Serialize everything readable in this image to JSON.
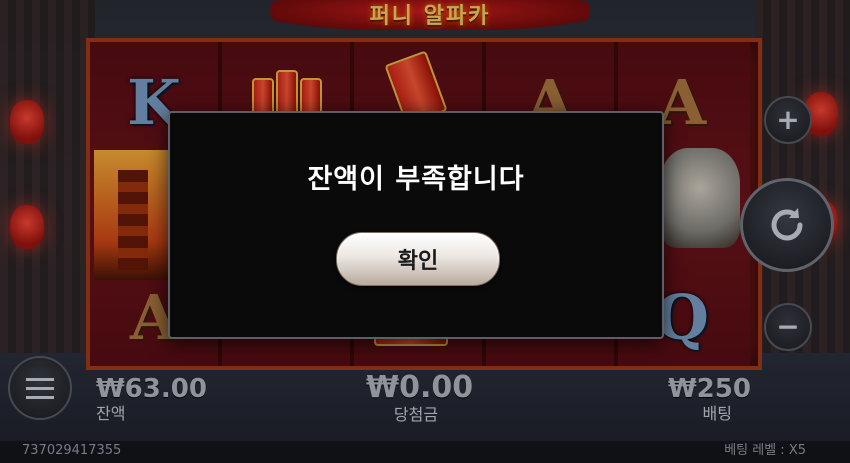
{
  "game": {
    "title": "퍼니 알파카"
  },
  "reels": {
    "symbols": {
      "col1_top": "K",
      "col1_bottom": "A",
      "col4_top": "A",
      "col5_top": "A",
      "col5_bottom": "Q"
    }
  },
  "controls": {
    "plus_icon": "plus-icon",
    "minus_icon": "minus-icon",
    "spin_icon": "refresh-icon",
    "menu_icon": "hamburger-icon"
  },
  "stats": {
    "balance_value": "₩63.00",
    "balance_label": "잔액",
    "win_value": "₩0.00",
    "win_label": "당첨금",
    "bet_value": "₩250",
    "bet_label": "배팅"
  },
  "footer": {
    "session_id": "737029417355",
    "bet_level": "베팅 레벨 : X5"
  },
  "modal": {
    "message": "잔액이 부족합니다",
    "confirm_label": "확인"
  },
  "colors": {
    "modal_bg": "#0a0a0b",
    "reel_bg": "#6d1515",
    "accent_gold": "#ffd86a"
  }
}
